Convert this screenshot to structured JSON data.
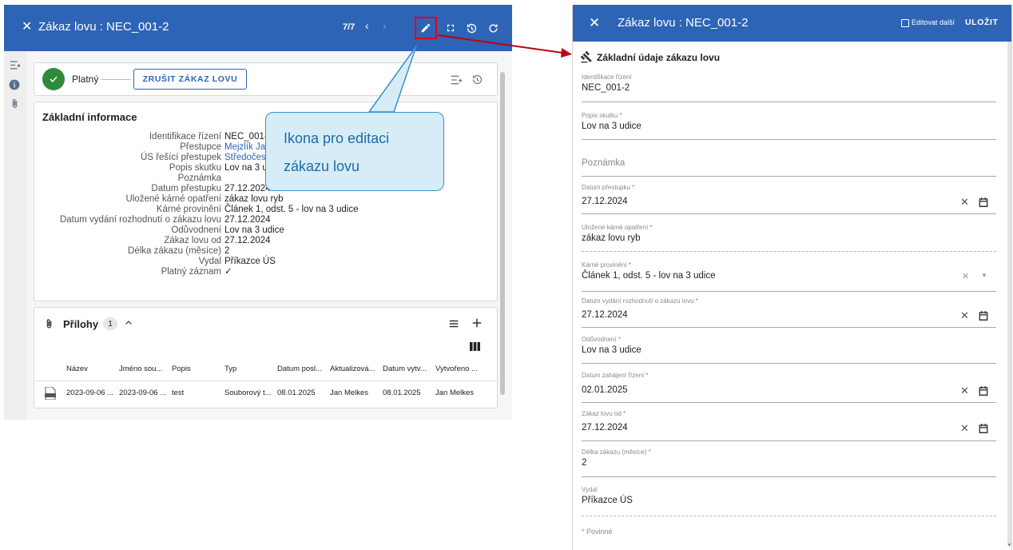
{
  "left_panel": {
    "header": {
      "title": "Zákaz lovu : NEC_001-2",
      "pager": "7/7"
    },
    "status": {
      "label": "Platný",
      "cancel_button": "ZRUŠIT ZÁKAZ LOVU"
    },
    "info": {
      "title": "Základní informace",
      "rows": [
        {
          "label": "Identifikace řízení",
          "value": "NEC_001-2"
        },
        {
          "label": "Přestupce",
          "value": "Mejzlík Ja"
        },
        {
          "label": "ÚS řešící přestupek",
          "value": "Středočes"
        },
        {
          "label": "Popis skutku",
          "value": "Lov na 3 u"
        },
        {
          "label": "Poznámka",
          "value": ""
        },
        {
          "label": "Datum přestupku",
          "value": "27.12.2024"
        },
        {
          "label": "Uložené kárné opatření",
          "value": "zákaz lovu ryb"
        },
        {
          "label": "Kárné provinění",
          "value": "Článek 1, odst. 5 - lov na 3 udice"
        },
        {
          "label": "Datum vydání rozhodnutí o zákazu lovu",
          "value": "27.12.2024"
        },
        {
          "label": "Odůvodnení",
          "value": "Lov na 3 udice"
        },
        {
          "label": "Zákaz lovu od",
          "value": "27.12.2024"
        },
        {
          "label": "Délka zákazu (měsíce)",
          "value": "2"
        },
        {
          "label": "Vydal",
          "value": "Příkazce ÚS"
        },
        {
          "label": "Platný záznam",
          "value": "✓"
        }
      ]
    },
    "attachments": {
      "title": "Přílohy",
      "count": "1",
      "columns": [
        "Název",
        "Jméno sou...",
        "Popis",
        "Typ",
        "Datum posl...",
        "Aktualizová...",
        "Datum vytv...",
        "Vytvořeno ..."
      ],
      "row": [
        "2023-09-06 ...",
        "2023-09-06 ...",
        "test",
        "Souborový t...",
        "08.01.2025",
        "Jan Melkes",
        "08.01.2025",
        "Jan Melkes"
      ]
    }
  },
  "callout": {
    "line1": "Ikona pro editaci",
    "line2": "zákazu lovu"
  },
  "right_panel": {
    "header": {
      "title": "Zákaz lovu : NEC_001-2",
      "edit_more_label": "Editovat další",
      "save_label": "ULOŽIT"
    },
    "section_title": "Základní údaje zákazu lovu",
    "fields": {
      "id": {
        "label": "Identifikace řízení",
        "value": "NEC_001-2"
      },
      "popis": {
        "label": "Popis skutku *",
        "value": "Lov na 3 udice"
      },
      "poznamka": {
        "placeholder": "Poznámka"
      },
      "datum_prestupku": {
        "label": "Datum přestupku *",
        "value": "27.12.2024"
      },
      "opatreni": {
        "label": "Uložené kárné opatření *",
        "value": "zákaz lovu ryb"
      },
      "provineni": {
        "label": "Kárné provinění *",
        "value": "Článek 1, odst. 5 - lov na 3 udice"
      },
      "datum_vydani": {
        "label": "Datum vydání rozhodnutí o zákazu lovu *",
        "value": "27.12.2024"
      },
      "oduvodneni": {
        "label": "Odůvodnení *",
        "value": "Lov na 3 udice"
      },
      "datum_zahajeni": {
        "label": "Datum zahájení řízení *",
        "value": "02.01.2025"
      },
      "zakaz_od": {
        "label": "Zákaz lovu od *",
        "value": "27.12.2024"
      },
      "delka": {
        "label": "Délka zákazu (měsíce) *",
        "value": "2"
      },
      "vydal": {
        "label": "Vydal",
        "value": "Příkazce ÚS"
      }
    },
    "required_note": "* Povinné"
  },
  "colors": {
    "header_blue": "#2e64b6",
    "highlight_red": "#e0001b",
    "callout_fill": "#d6edf8",
    "callout_text": "#1f6aa6",
    "ok_green": "#2e8b3a"
  },
  "icons": [
    "close-icon",
    "chevron-left-icon",
    "chevron-right-icon",
    "pencil-icon",
    "fullscreen-icon",
    "history-icon",
    "refresh-icon",
    "filter-list-icon",
    "info-icon",
    "paperclip-icon",
    "check-icon",
    "list-icon",
    "plus-icon",
    "columns-icon",
    "file-icon",
    "gavel-icon",
    "calendar-icon",
    "dropdown-icon"
  ]
}
